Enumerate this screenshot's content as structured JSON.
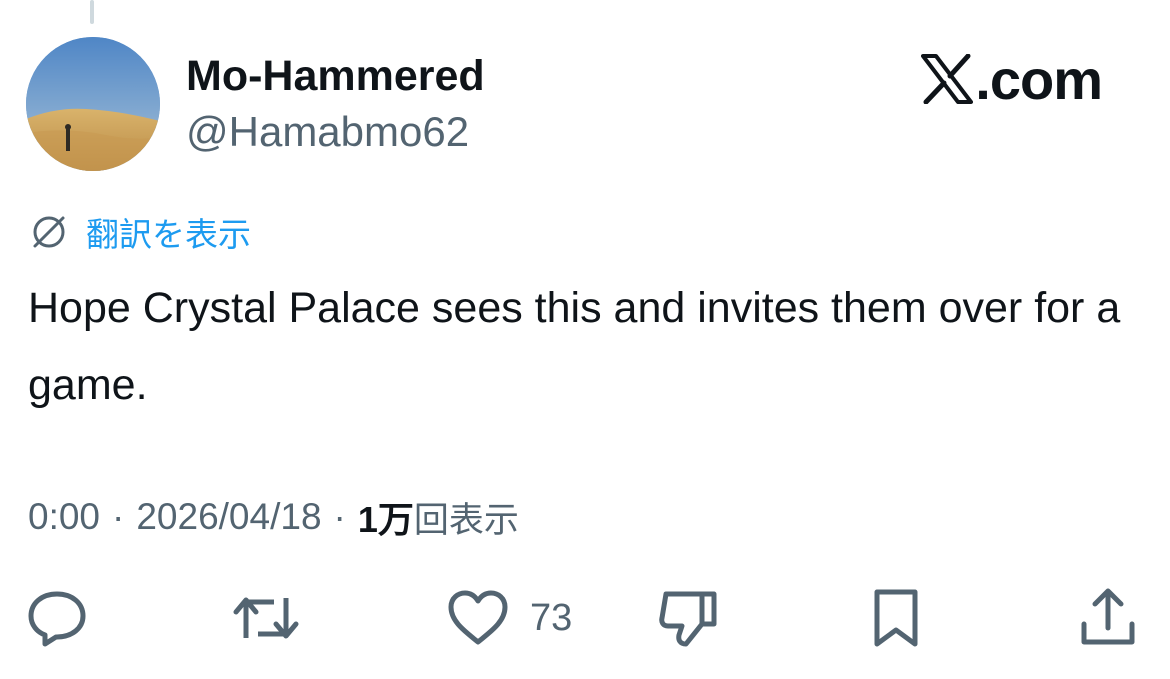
{
  "post": {
    "author": {
      "display_name": "Mo-Hammered",
      "handle": "@Hamabmo62",
      "avatar_icon": "avatar-desert-dunes"
    },
    "brand": {
      "text": ".com",
      "logo_icon": "x-logo-icon"
    },
    "translate": {
      "label": "翻訳を表示",
      "icon": "globe-slash-icon"
    },
    "text": "Hope Crystal Palace sees this and invites them over for a game.",
    "meta": {
      "time": "0:00",
      "separator": "·",
      "date": "2026/04/18",
      "views_count": "1万",
      "views_label": "回表示"
    },
    "actions": {
      "reply_icon": "reply-icon",
      "repost_icon": "repost-icon",
      "like_icon": "heart-icon",
      "like_count": "73",
      "dislike_icon": "thumbs-down-icon",
      "bookmark_icon": "bookmark-icon",
      "share_icon": "share-icon"
    }
  },
  "colors": {
    "text_primary": "#0f1419",
    "text_secondary": "#536471",
    "link": "#1d9bf0",
    "icon": "#536471"
  }
}
